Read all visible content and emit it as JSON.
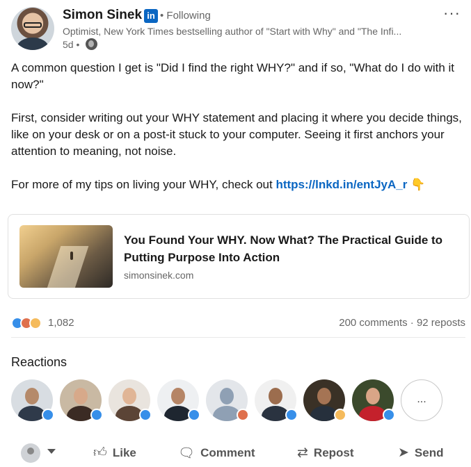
{
  "post": {
    "author_name": "Simon Sinek",
    "linkedin_badge": "in",
    "follow_status": "• Following",
    "headline": "Optimist, New York Times bestselling author of \"Start with Why\" and \"The Infi...",
    "age": "5d •",
    "more_label": "···",
    "paragraph_1": "A common question I get is \"Did I find the right WHY?\" and if so, \"What do I do with it now?\"",
    "paragraph_2": "First, consider writing out your WHY statement and placing it where you decide things, like on your desk or on a post-it stuck to your computer. Seeing it first anchors your attention to meaning, not noise.",
    "paragraph_3_prefix": "For more of my tips on living your WHY, check out ",
    "link_text": "https://lnkd.in/entJyA_r",
    "emoji": "👇"
  },
  "link_card": {
    "title": "You Found Your WHY. Now What? The Practical Guide to Putting Purpose Into Action",
    "domain": "simonsinek.com"
  },
  "social": {
    "reaction_count": "1,082",
    "comments_reposts": "200 comments · 92 reposts",
    "reaction_colors": {
      "like": "#378fe9",
      "love": "#df704d",
      "insight": "#f5bb5c"
    }
  },
  "reactions": {
    "title": "Reactions",
    "more_label": "...",
    "people": [
      {
        "icon": "like"
      },
      {
        "icon": "like"
      },
      {
        "icon": "like"
      },
      {
        "icon": "like"
      },
      {
        "icon": "love"
      },
      {
        "icon": "like"
      },
      {
        "icon": "insight"
      },
      {
        "icon": "like"
      }
    ]
  },
  "actions": {
    "like": "Like",
    "comment": "Comment",
    "repost": "Repost",
    "send": "Send"
  },
  "colors": {
    "link": "#0a66c2",
    "text": "#191919",
    "muted": "#666666"
  }
}
